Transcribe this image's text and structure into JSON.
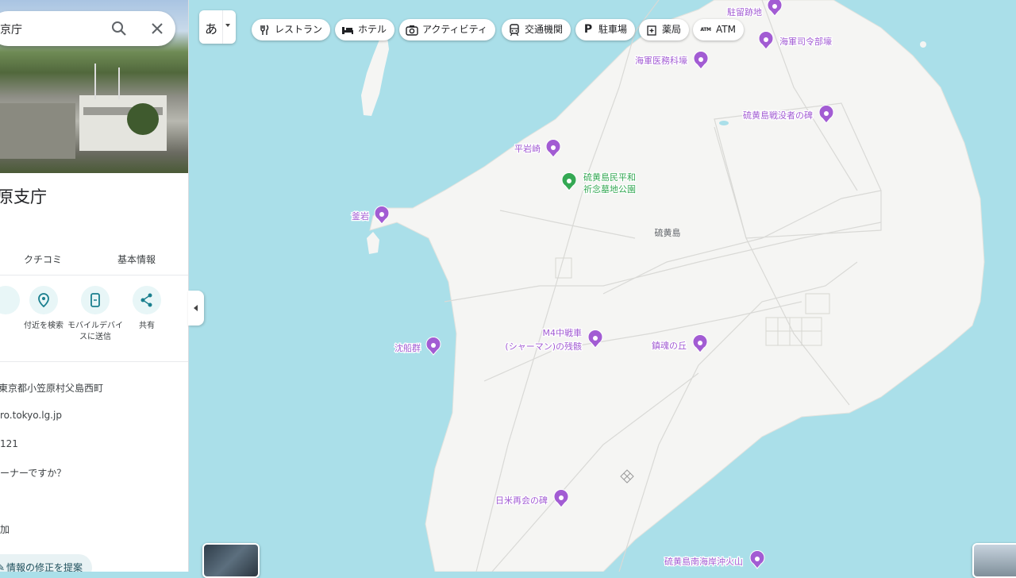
{
  "search": {
    "query": "京庁"
  },
  "place": {
    "title": "原支庁",
    "tabs": [
      "クチコミ",
      "基本情報"
    ],
    "actions": [
      {
        "label": "付近を検索",
        "icon": "nearby-icon"
      },
      {
        "label": "モバイルデバイスに送信",
        "icon": "send-to-phone-icon"
      },
      {
        "label": "共有",
        "icon": "share-icon"
      }
    ],
    "info": {
      "address": "東京都小笠原村父島西町",
      "website": "ro.tokyo.lg.jp",
      "phone": "121",
      "owner_prompt": "ーナーですか？",
      "add": "加"
    },
    "suggest_edit": "情報の修正を提案"
  },
  "toolbar": {
    "language_glyph": "あ",
    "chips": [
      {
        "label": "レストラン",
        "icon": "restaurant-icon"
      },
      {
        "label": "ホテル",
        "icon": "hotel-icon"
      },
      {
        "label": "アクティビティ",
        "icon": "camera-icon"
      },
      {
        "label": "交通機関",
        "icon": "transit-icon"
      },
      {
        "label": "駐車場",
        "icon": "parking-icon"
      },
      {
        "label": "薬局",
        "icon": "pharmacy-icon"
      },
      {
        "label": "ATM",
        "icon": "atm-icon"
      }
    ]
  },
  "map": {
    "colors": {
      "water": "#aadfe9",
      "land": "#f5f5f3",
      "road": "#d9d9d6",
      "poi": "#a25cd3",
      "park": "#34a853"
    },
    "labels": {
      "island": "硫黄島",
      "park_line1": "硫黄島民平和",
      "park_line2": "祈念墓地公園"
    },
    "pois": [
      {
        "label": "駐留跡地"
      },
      {
        "label": "海軍司令部壕"
      },
      {
        "label": "海軍医務科壕"
      },
      {
        "label": "硫黄島戦没者の碑"
      },
      {
        "label": "平岩崎"
      },
      {
        "label": "釜岩"
      },
      {
        "label": "M4中戦車"
      },
      {
        "label": "(シャーマン)の残骸"
      },
      {
        "label": "鎮魂の丘"
      },
      {
        "label": "沈船群"
      },
      {
        "label": "日米再会の碑"
      },
      {
        "label": "硫黄島南海岸沖火山"
      }
    ]
  }
}
